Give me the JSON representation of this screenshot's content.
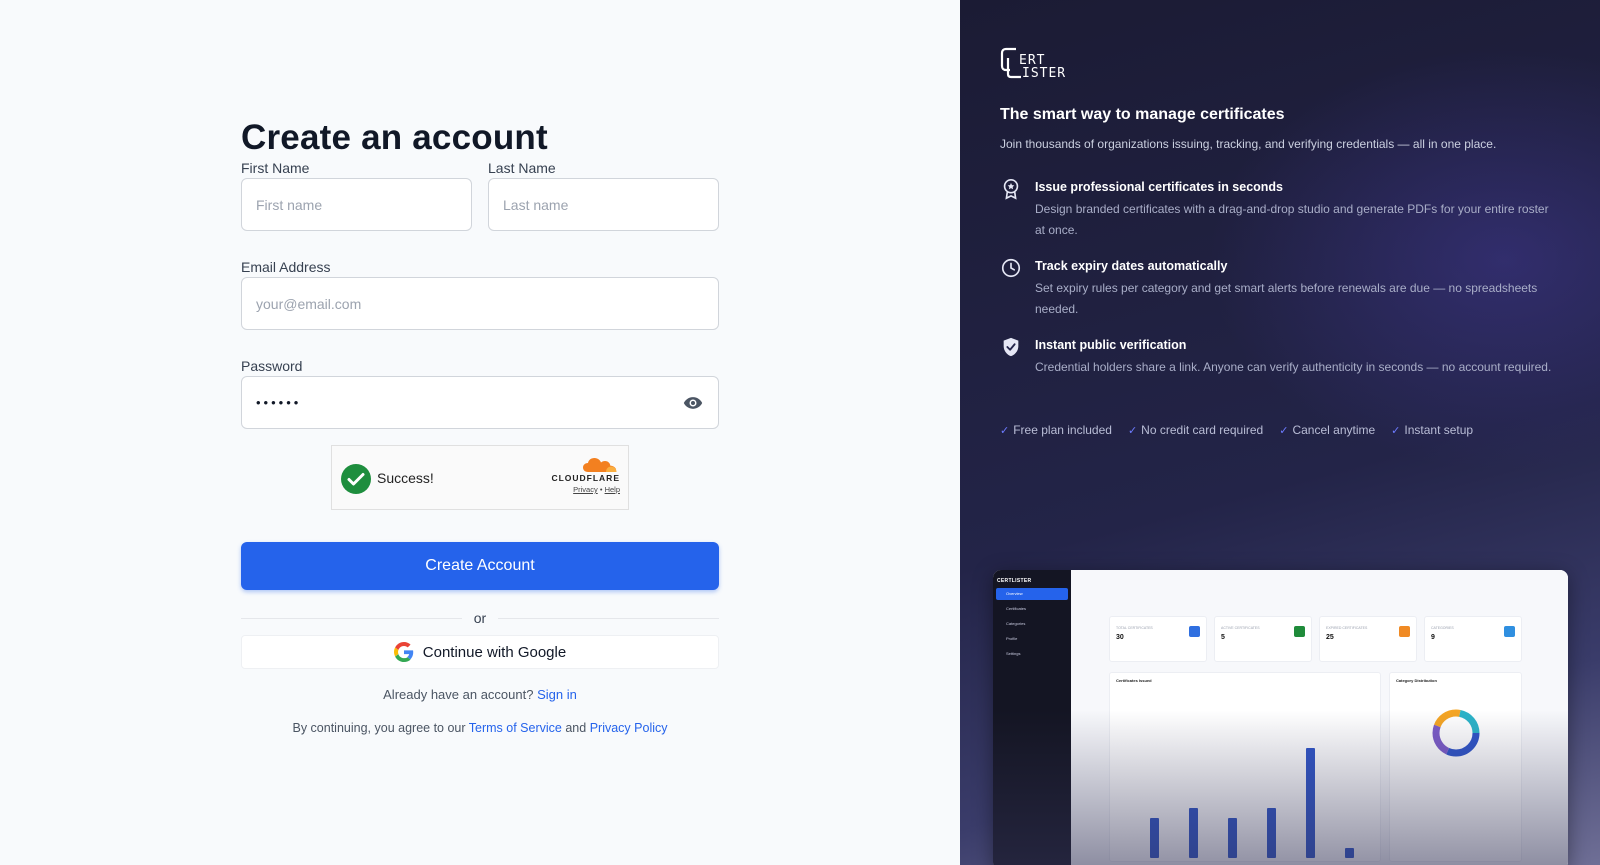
{
  "form": {
    "title": "Create an account",
    "first_name": {
      "label": "First Name",
      "placeholder": "First name"
    },
    "last_name": {
      "label": "Last Name",
      "placeholder": "Last name"
    },
    "email": {
      "label": "Email Address",
      "placeholder": "your@email.com"
    },
    "password": {
      "label": "Password",
      "value": "••••••"
    },
    "captcha": {
      "status": "Success!",
      "brand": "CLOUDFLARE",
      "privacy": "Privacy",
      "sep": "•",
      "help": "Help"
    },
    "submit_label": "Create Account",
    "divider": "or",
    "google_label": "Continue with Google",
    "signin_prompt": "Already have an account?",
    "signin_link": "Sign in",
    "terms_prefix": "By continuing, you agree to our",
    "terms_link": "Terms of Service",
    "terms_and": "and",
    "privacy_link": "Privacy Policy"
  },
  "hero": {
    "headline": "The smart way to manage certificates",
    "subheadline": "Join thousands of organizations issuing, tracking, and verifying credentials — all in one place.",
    "features": [
      {
        "icon": "award-icon",
        "title": "Issue professional certificates in seconds",
        "desc": "Design branded certificates with a drag-and-drop studio and generate PDFs for your entire roster at once."
      },
      {
        "icon": "clock-icon",
        "title": "Track expiry dates automatically",
        "desc": "Set expiry rules per category and get smart alerts before renewals are due — no spreadsheets needed."
      },
      {
        "icon": "shield-check-icon",
        "title": "Instant public verification",
        "desc": "Credential holders share a link. Anyone can verify authenticity in seconds — no account required."
      }
    ],
    "perks": [
      "Free plan included",
      "No credit card required",
      "Cancel anytime",
      "Instant setup"
    ],
    "accent": "#2563eb"
  },
  "mock": {
    "brand": "CERTLISTER",
    "nav": [
      "Overview",
      "Certificates",
      "Categories",
      "Profile",
      "Settings"
    ],
    "cards": [
      {
        "label": "TOTAL CERTIFICATES",
        "value": "30",
        "color": "#2f6fe0"
      },
      {
        "label": "ACTIVE CERTIFICATES",
        "value": "5",
        "color": "#1f8b3a"
      },
      {
        "label": "EXPIRED CERTIFICATES",
        "value": "25",
        "color": "#f08a24"
      },
      {
        "label": "CATEGORIES",
        "value": "9",
        "color": "#2f8fe0"
      }
    ],
    "panel_issued": "Certificates Issued",
    "panel_dist": "Category Distribution",
    "bars": [
      4,
      5,
      4,
      5,
      11,
      1
    ],
    "bars_max": 12
  }
}
